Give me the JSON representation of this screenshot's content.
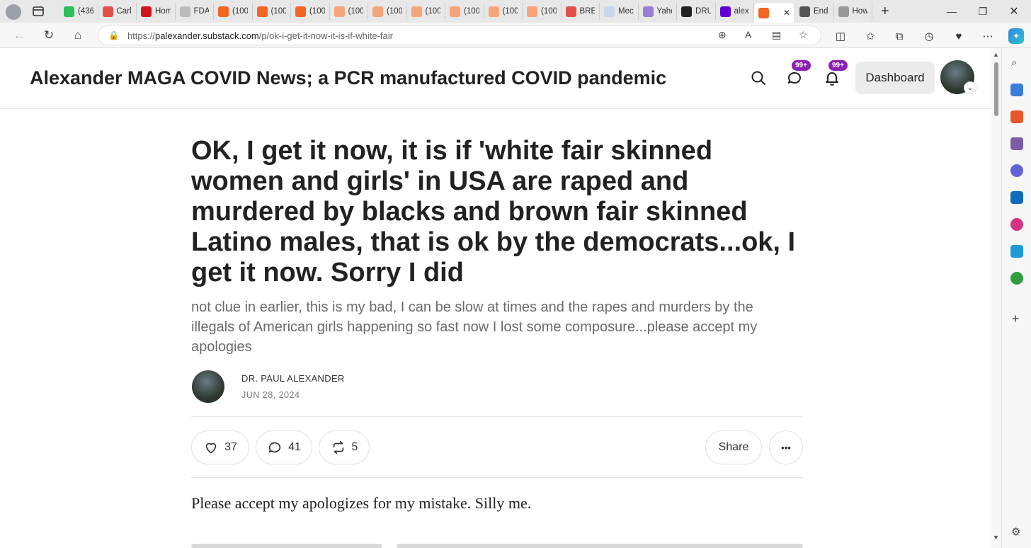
{
  "browser": {
    "tabs": [
      {
        "label": "(436",
        "color": "#2fbf5a"
      },
      {
        "label": "Carly",
        "color": "#e0504d"
      },
      {
        "label": "Hom",
        "color": "#d0141c"
      },
      {
        "label": "FDA",
        "color": "#bbbbbb"
      },
      {
        "label": "(100",
        "color": "#f26522"
      },
      {
        "label": "(100",
        "color": "#f26522"
      },
      {
        "label": "(100",
        "color": "#f26522"
      },
      {
        "label": "(100",
        "color": "#f6a47a"
      },
      {
        "label": "(100",
        "color": "#f6a47a"
      },
      {
        "label": "(100",
        "color": "#f6a47a"
      },
      {
        "label": "(100",
        "color": "#f6a47a"
      },
      {
        "label": "(100",
        "color": "#f6a47a"
      },
      {
        "label": "(100",
        "color": "#f6a47a"
      },
      {
        "label": "BRE/",
        "color": "#e0504d"
      },
      {
        "label": "Mec",
        "color": "#c8d7ec"
      },
      {
        "label": "Yahc",
        "color": "#9b7fd4"
      },
      {
        "label": "DRU",
        "color": "#222222"
      },
      {
        "label": "alex",
        "color": "#6001d2"
      },
      {
        "label": "",
        "color": "#f26522",
        "active": true
      },
      {
        "label": "End",
        "color": "#555555"
      },
      {
        "label": "How",
        "color": "#999999"
      }
    ],
    "url": {
      "scheme": "https://",
      "host": "palexander.substack.com",
      "path": "/p/ok-i-get-it-now-it-is-if-white-fair"
    }
  },
  "header": {
    "site_title": "Alexander MAGA COVID News; a PCR manufactured COVID pandemic",
    "chat_badge": "99+",
    "notif_badge": "99+",
    "dashboard_label": "Dashboard"
  },
  "post": {
    "title": "OK, I get it now, it is if 'white fair skinned women and girls' in USA are raped and murdered by blacks and brown fair skinned Latino males, that is ok by the democrats...ok, I get it now. Sorry I did",
    "subtitle": "not clue in earlier, this is my bad, I can be slow at times and the rapes and murders by the illegals of American girls happening so fast now I lost some composure...please accept my apologies",
    "author": "DR. PAUL ALEXANDER",
    "date": "JUN 28, 2024",
    "likes": "37",
    "comments": "41",
    "restacks": "5",
    "share_label": "Share",
    "more_label": "•••",
    "body": "Please accept my apologizes for my mistake. Silly me."
  },
  "colors": {
    "accent": "#ff6719",
    "badge": "#8e1fb3"
  }
}
